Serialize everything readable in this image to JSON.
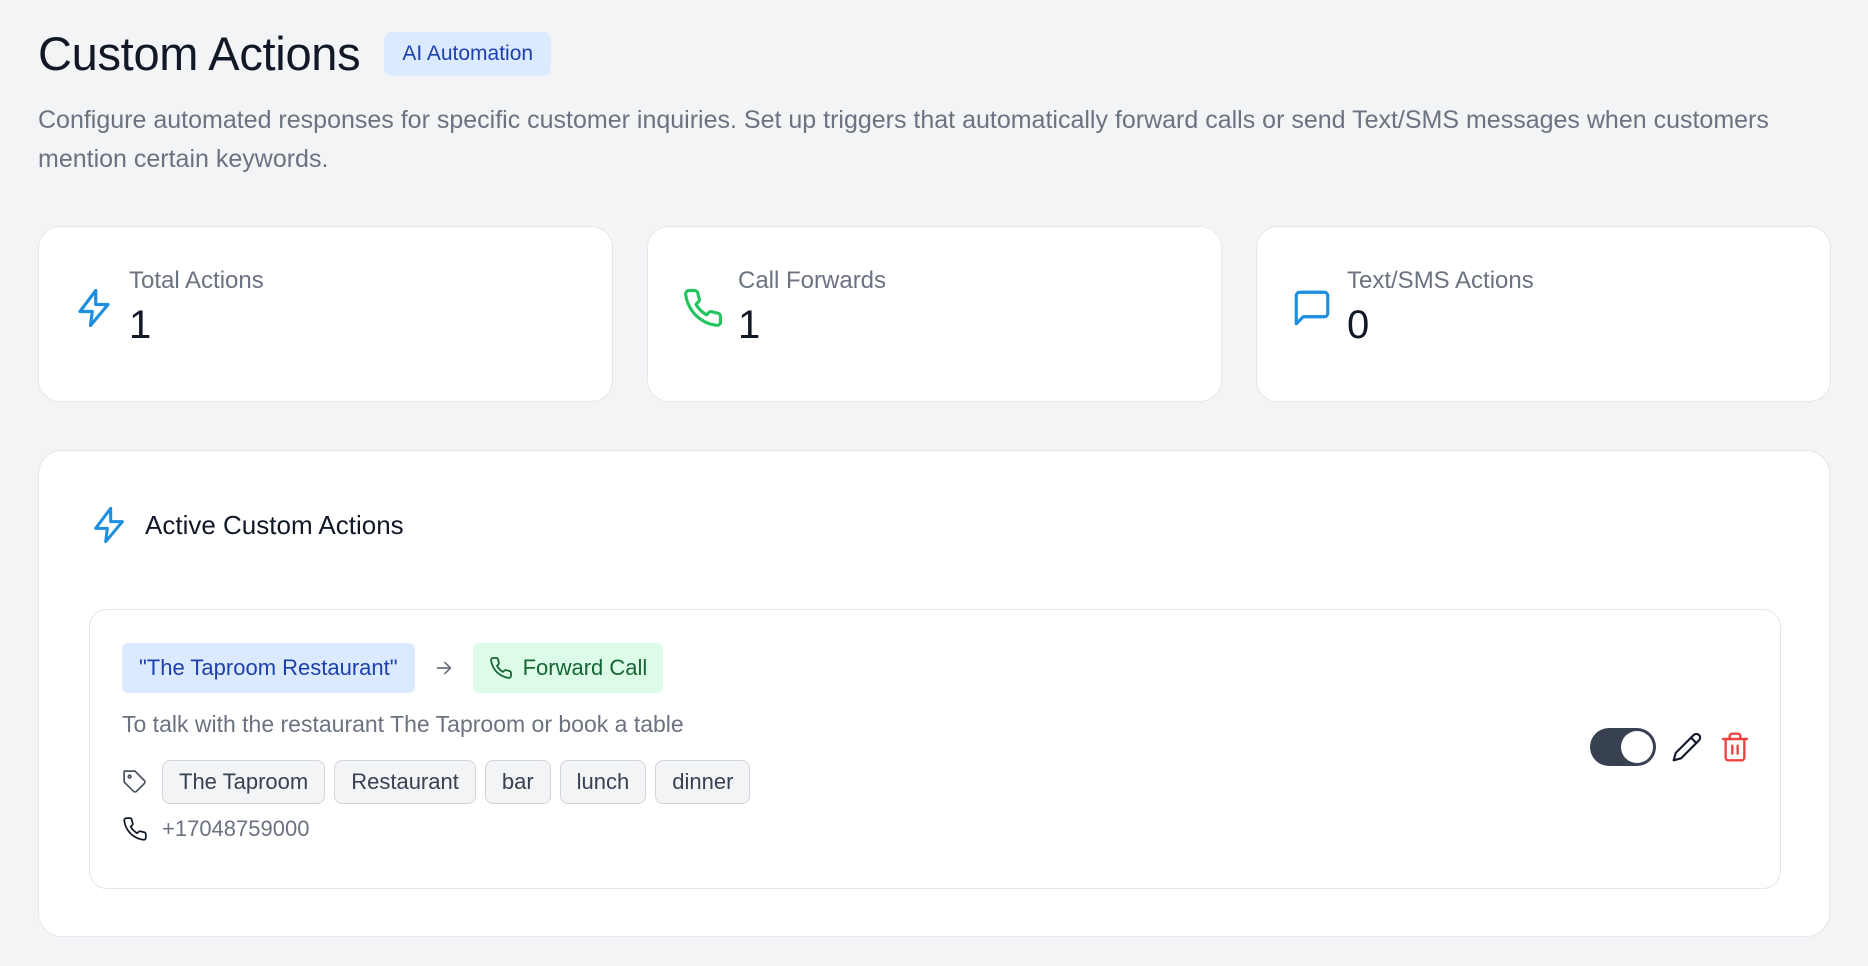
{
  "header": {
    "title": "Custom Actions",
    "badge": "AI Automation",
    "subtitle": "Configure automated responses for specific customer inquiries. Set up triggers that automatically forward calls or send Text/SMS messages when customers mention certain keywords."
  },
  "stats": [
    {
      "label": "Total Actions",
      "value": "1",
      "icon": "lightning-icon",
      "color": "#1d8fe1"
    },
    {
      "label": "Call Forwards",
      "value": "1",
      "icon": "phone-icon",
      "color": "#22c55e"
    },
    {
      "label": "Text/SMS Actions",
      "value": "0",
      "icon": "message-icon",
      "color": "#1d8fe1"
    }
  ],
  "panel": {
    "title": "Active Custom Actions",
    "actions": [
      {
        "trigger": "\"The Taproom Restaurant\"",
        "action_type": "Forward Call",
        "description": "To talk with the restaurant The Taproom or book a table",
        "keywords": [
          "The Taproom",
          "Restaurant",
          "bar",
          "lunch",
          "dinner"
        ],
        "phone": "+17048759000",
        "enabled": true
      }
    ]
  },
  "colors": {
    "accent_blue": "#1d8fe1",
    "green": "#22c55e",
    "delete_red": "#ef4444",
    "trigger_bg": "#dbeafe",
    "forward_bg": "#dcfce7"
  }
}
